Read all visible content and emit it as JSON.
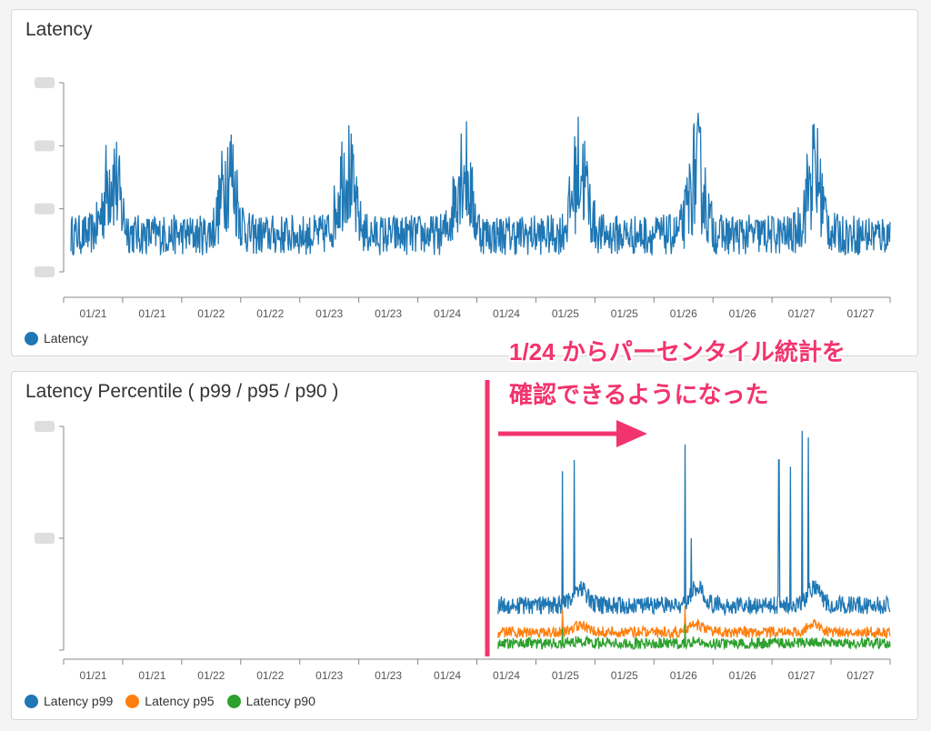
{
  "annotation": {
    "line1": "1/24 からパーセンタイル統計を",
    "line2": "確認できるようになった",
    "color": "#f2346e"
  },
  "chart_data": [
    {
      "type": "line",
      "title": "Latency",
      "x_tick_labels": [
        "01/21",
        "01/21",
        "01/22",
        "01/22",
        "01/23",
        "01/23",
        "01/24",
        "01/24",
        "01/25",
        "01/25",
        "01/26",
        "01/26",
        "01/27",
        "01/27"
      ],
      "x_range_days": [
        0,
        7
      ],
      "y_range": [
        0,
        1
      ],
      "y_ticks": 4,
      "series": [
        {
          "name": "Latency",
          "color": "#1f77b4",
          "start_day": 0,
          "end_day": 7,
          "daily_peaks": [
            0.83,
            0.88,
            0.92,
            0.95,
            0.9,
            0.86,
            0.84
          ],
          "daily_peak_day_fraction": 0.35,
          "baseline": 0.16,
          "noise": 0.42
        }
      ],
      "legend_position": "bottom-left"
    },
    {
      "type": "line",
      "title": "Latency Percentile ( p99 / p95 / p90 )",
      "x_tick_labels": [
        "01/21",
        "01/21",
        "01/22",
        "01/22",
        "01/23",
        "01/23",
        "01/24",
        "01/24",
        "01/25",
        "01/25",
        "01/26",
        "01/26",
        "01/27",
        "01/27"
      ],
      "x_range_days": [
        0,
        7
      ],
      "y_range": [
        0,
        1
      ],
      "y_ticks": 3,
      "data_start_day": 3.65,
      "series": [
        {
          "name": "Latency p99",
          "color": "#1f77b4",
          "level": 0.2,
          "spikes": [
            [
              4.2,
              0.8
            ],
            [
              4.3,
              0.85
            ],
            [
              5.25,
              0.92
            ],
            [
              5.3,
              0.5
            ],
            [
              6.05,
              0.85
            ],
            [
              6.15,
              0.82
            ],
            [
              6.25,
              0.98
            ],
            [
              6.3,
              0.95
            ]
          ]
        },
        {
          "name": "Latency p95",
          "color": "#ff7f0e",
          "level": 0.08,
          "spikes": [
            [
              4.2,
              0.18
            ],
            [
              5.25,
              0.2
            ]
          ]
        },
        {
          "name": "Latency p90",
          "color": "#2ca02c",
          "level": 0.03,
          "spikes": [
            [
              4.2,
              0.1
            ],
            [
              5.25,
              0.12
            ]
          ]
        }
      ],
      "legend_position": "bottom-left"
    }
  ]
}
